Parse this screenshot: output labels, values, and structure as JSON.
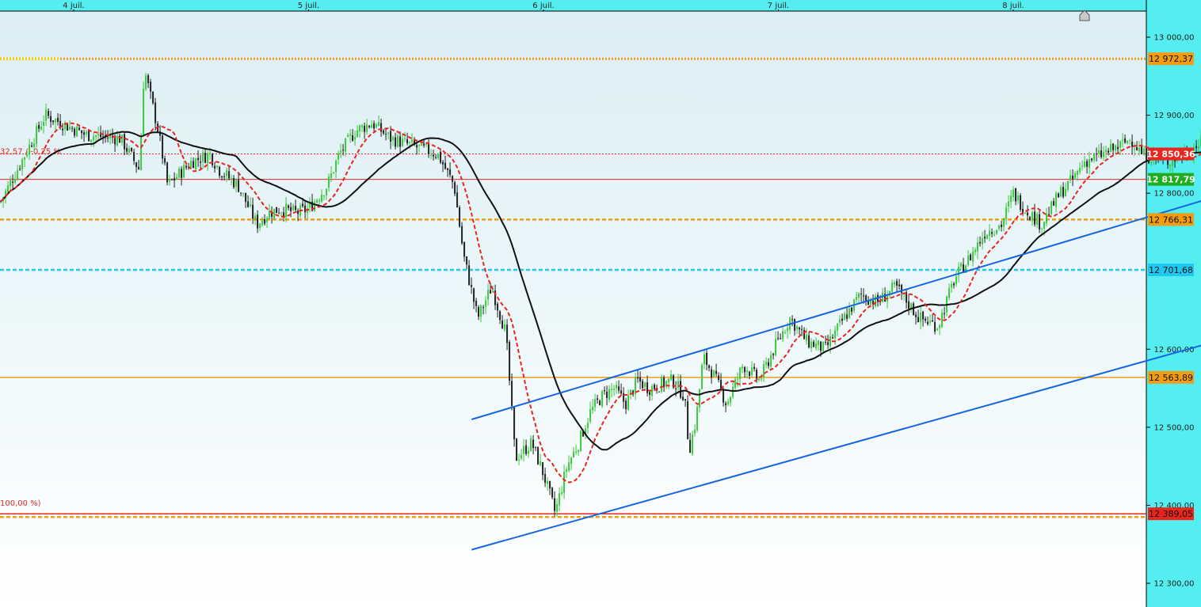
{
  "chart_data": {
    "type": "candlestick",
    "title": "",
    "xlabel": "",
    "ylabel": "",
    "ylim": [
      12270,
      13040
    ],
    "x_axis": {
      "labels": [
        "4 juil.",
        "5 juil.",
        "6 juil.",
        "7 juil.",
        "8 juil."
      ]
    },
    "y_axis": {
      "ticks": [
        {
          "value": 13000,
          "label": "13 000,00"
        },
        {
          "value": 12900,
          "label": "12 900,00"
        },
        {
          "value": 12800,
          "label": "12 800,00"
        },
        {
          "value": 12600,
          "label": "12 600,00"
        },
        {
          "value": 12500,
          "label": "12 500,00"
        },
        {
          "value": 12400,
          "label": "12 400,00"
        },
        {
          "value": 12300,
          "label": "12 300,00"
        }
      ]
    },
    "levels": [
      {
        "value": 12972.37,
        "label": "12 972,37",
        "color": "#f39c12",
        "style": "dotted"
      },
      {
        "value": 12850.36,
        "label": "12 850,36",
        "color": "#e8261e",
        "style": "thin-dotted"
      },
      {
        "value": 12817.79,
        "label": "12 817,79",
        "color": "#1fae1f",
        "style": "solid-thin"
      },
      {
        "value": 12766.31,
        "label": "12 766,31",
        "color": "#f39c12",
        "style": "dashed"
      },
      {
        "value": 12701.68,
        "label": "12 701,68",
        "color": "#1ec8f0",
        "style": "dashed"
      },
      {
        "value": 12563.89,
        "label": "12 563,89",
        "color": "#f39c12",
        "style": "solid"
      },
      {
        "value": 12389.05,
        "label": "12 389,05",
        "color": "#e8261e",
        "style": "solid"
      }
    ],
    "fib_labels": [
      {
        "text": "32,57 / -0,25 %",
        "value": 12850.36
      },
      {
        "text": "100,00 %)",
        "value": 12389.05
      }
    ],
    "channel": {
      "color": "#1565e0",
      "upper": [
        {
          "day": 1.694,
          "value": 12510
        },
        {
          "day": 6.653,
          "value": 12957
        }
      ],
      "lower": [
        {
          "day": 1.694,
          "value": 12343
        },
        {
          "day": 6.653,
          "value": 12761
        }
      ]
    },
    "colors": {
      "up": "#3cc83c",
      "down": "#222222",
      "ma_fast": "#e8261e",
      "ma_slow": "#111111",
      "background_top": "#dbeef4",
      "background_bottom": "#ffffff",
      "axis_bg": "#55eef0"
    },
    "grid": false
  }
}
